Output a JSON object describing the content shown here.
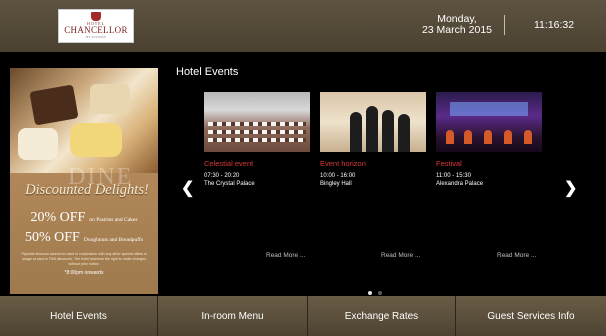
{
  "header": {
    "logo": {
      "hotel": "HOTEL",
      "name": "CHANCELLOR",
      "sub": "BY SUNWAY"
    },
    "day": "Monday,",
    "date": "23 March 2015",
    "time": "11:16:32"
  },
  "ad": {
    "watermark": "DINE",
    "title": "Discounted Delights!",
    "line1_big": "20% OFF",
    "line1_small": "on Pastries and Cakes",
    "line2_big": "50% OFF",
    "line2_small": "Doughnuts and Breadpuffs",
    "fine_print": "*Special discount cannot be used in conjunction with any other special offers or usage of card or F&B discounts. The hotel reserves the right to make changes without prior notice.",
    "from": "*8:00pm onwards"
  },
  "events": {
    "title": "Hotel Events",
    "read_more": "Read More ...",
    "items": [
      {
        "name": "Celestial event",
        "time": "07:30 - 20:20",
        "venue": "The Crystal Palace"
      },
      {
        "name": "Event horizon",
        "time": "10:00 - 16:00",
        "venue": "Bingley Hall"
      },
      {
        "name": "Festival",
        "time": "11:00 - 15:30",
        "venue": "Alexandra Palace"
      }
    ],
    "page_count": 2,
    "active_page": 1
  },
  "nav": {
    "items": [
      {
        "label": "Hotel Events"
      },
      {
        "label": "In-room Menu"
      },
      {
        "label": "Exchange Rates"
      },
      {
        "label": "Guest Services Info"
      }
    ]
  },
  "colors": {
    "header_bg": "#5e5340",
    "nav_bg": "#6a5d46",
    "event_name": "#d8383a",
    "background": "#000000"
  }
}
